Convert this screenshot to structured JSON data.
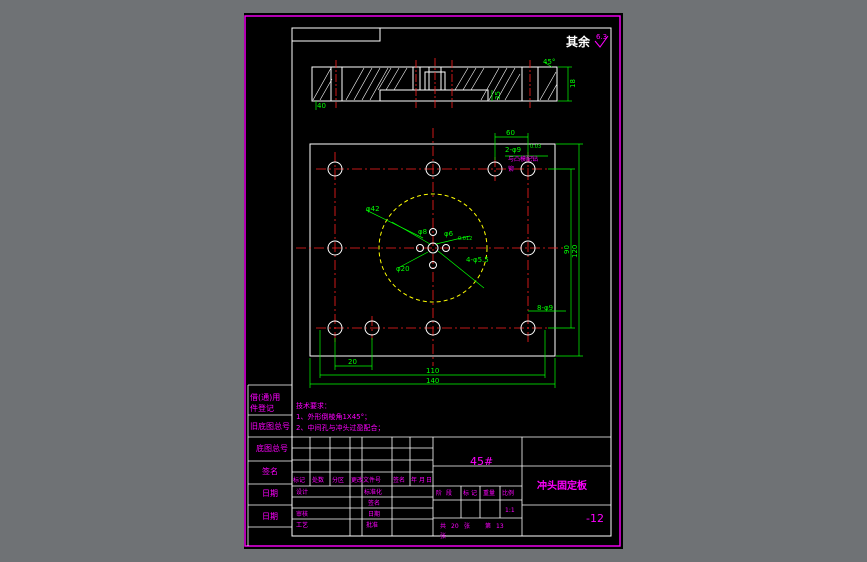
{
  "colors": {
    "viewport": "#6f7275",
    "paper": "#000000",
    "frame": "#ff00ff",
    "outline": "#ffffff",
    "centerline": "#ff2020",
    "dimension": "#00ff00",
    "hidden": "#ffff00",
    "note": "#ff00ff"
  },
  "drawing": {
    "roughness_label": "其余",
    "roughness_value": "6.3",
    "section_dims": {
      "right_height": "18",
      "right_top": "45°",
      "left_bottom": "40",
      "mid_height": "35"
    },
    "plan_dims": {
      "top_offset": "60",
      "holes_4": "2-φ9",
      "holes_4_tol": "0.03",
      "note_process": "与凸模配钻",
      "note_tag": "铆",
      "circle_large": "φ42",
      "circle_mid": "φ8",
      "center_hole": "φ6",
      "center_hole_tol": "0.012",
      "small_holes": "4-φ5.5",
      "circle_small": "φ20",
      "height_inner": "90",
      "height_outer": "120",
      "side_holes": "8-φ9",
      "left_offset": "20",
      "width_inner": "110",
      "width_outer": "140"
    },
    "tech_title": "技术要求：",
    "tech_notes": [
      "1、外形倒棱角1X45°；",
      "2、中间孔与冲头过盈配合；"
    ]
  },
  "side_column": [
    "借(通)用",
    "件登记",
    "旧底图总号",
    "底图总号",
    "签名",
    "日期",
    "日期"
  ],
  "title_block": {
    "material": "45#",
    "part_name": "冲头固定板",
    "drawing_number": "-12",
    "revision_labels": [
      "标记",
      "处数",
      "分区",
      "更改文件号",
      "签名",
      "年",
      "月",
      "日"
    ],
    "staff_labels": [
      "设计",
      "审核",
      "工艺"
    ],
    "standard_labels": [
      "标准化",
      "批准"
    ],
    "approve_labels": [
      "签名",
      "日期"
    ],
    "stage_labels": [
      "阶",
      "段",
      "标",
      "记",
      "重量",
      "比例"
    ],
    "scale": "1:1",
    "sheet_total_label": "共",
    "sheets_total": "20",
    "sheet_unit": "张",
    "sheet_current_label": "第",
    "sheet_current": "13",
    "sheet_suffix": "张"
  }
}
